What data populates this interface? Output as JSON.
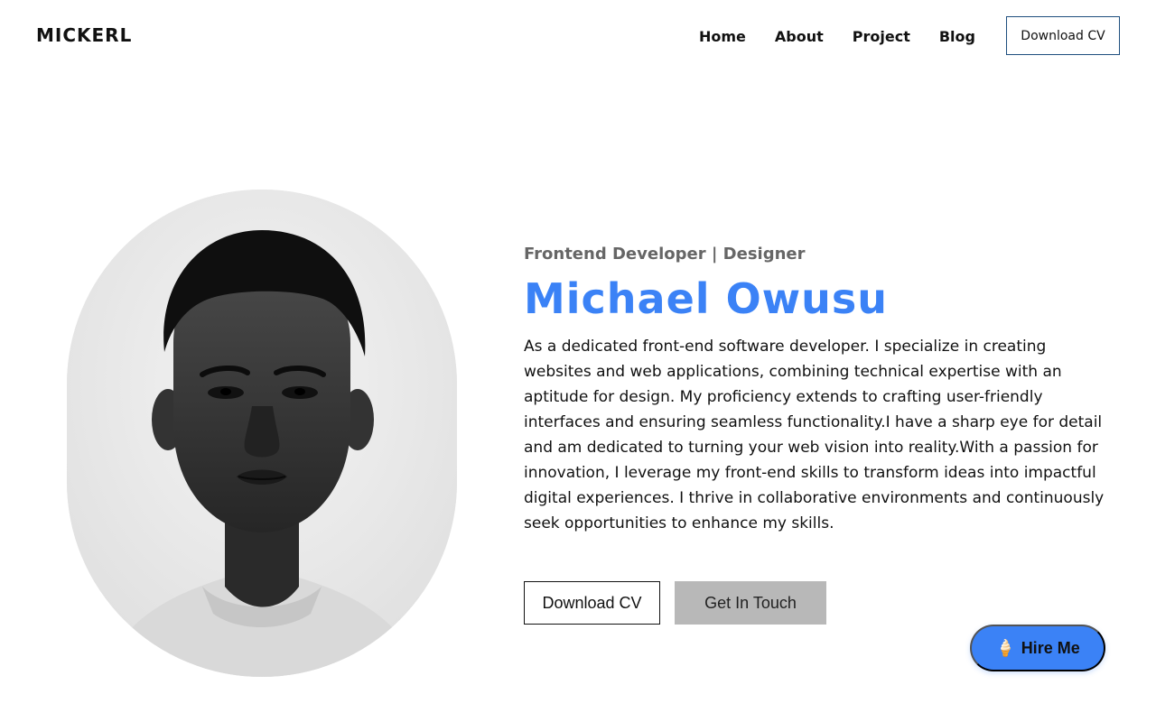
{
  "header": {
    "brand": "MICKERL",
    "nav": [
      "Home",
      "About",
      "Project",
      "Blog"
    ],
    "cv_button": "Download CV"
  },
  "hero": {
    "subtitle": "Frontend Developer | Designer",
    "name": "Michael Owusu",
    "bio": "As a dedicated front-end software developer. I specialize in creating websites and web applications, combining technical expertise with an aptitude for design. My proficiency extends to crafting user-friendly interfaces and ensuring seamless functionality.I have a sharp eye for detail and am dedicated to turning your web vision into reality.With a passion for innovation, I leverage my front-end skills to transform ideas into impactful digital experiences. I thrive in collaborative environments and continuously seek opportunities to enhance my skills.",
    "download_button": "Download CV",
    "touch_button": "Get In Touch"
  },
  "hire": {
    "icon": "ice-cream-icon",
    "emoji": "🍦",
    "label": "Hire Me"
  },
  "colors": {
    "accent": "#3b82f6",
    "secondary_button": "#b8b8b8",
    "subtitle": "#666666"
  }
}
